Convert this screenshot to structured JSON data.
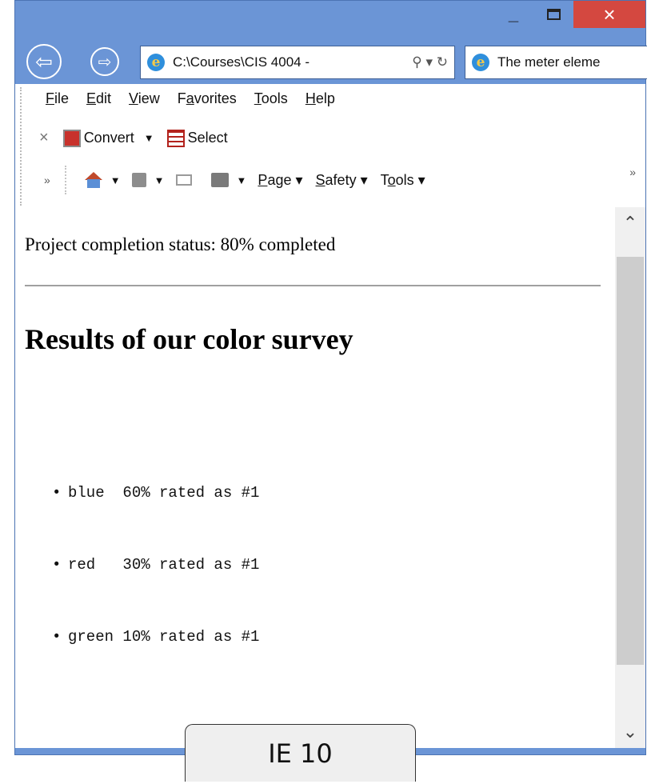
{
  "window": {
    "controls": {
      "minimize": "_",
      "close": "×"
    }
  },
  "address_bar": {
    "url": "C:\\Courses\\CIS 4004 -",
    "search_glyph": "⚲ ▾",
    "refresh_glyph": "↻"
  },
  "tab": {
    "title": "The meter eleme"
  },
  "menu": {
    "items": [
      {
        "key": "F",
        "rest": "ile"
      },
      {
        "key": "E",
        "rest": "dit"
      },
      {
        "key": "V",
        "rest": "iew"
      },
      {
        "pre": "F",
        "key": "a",
        "rest": "vorites"
      },
      {
        "key": "T",
        "rest": "ools"
      },
      {
        "key": "H",
        "rest": "elp"
      }
    ]
  },
  "command_bar": {
    "close_glyph": "×",
    "convert_label": "Convert",
    "select_label": "Select",
    "more_glyph": "»",
    "page_key": "P",
    "page_rest": "age",
    "safety_key": "S",
    "safety_rest": "afety",
    "tools_pre": "T",
    "tools_key": "o",
    "tools_rest": "ols"
  },
  "page": {
    "status_text": "Project completion status: 80% completed",
    "heading": "Results of our color survey",
    "results": [
      {
        "text": "blue  60% rated as #1"
      },
      {
        "text": "red   30% rated as #1"
      },
      {
        "text": "green 10% rated as #1"
      }
    ]
  },
  "scrollbar": {
    "up_glyph": "⌃",
    "down_glyph": "⌄"
  },
  "callout": {
    "label": "IE 10"
  },
  "colors": {
    "frame": "#6b95d6",
    "close_button": "#d44840",
    "scroll_thumb": "#cdcdcd"
  }
}
